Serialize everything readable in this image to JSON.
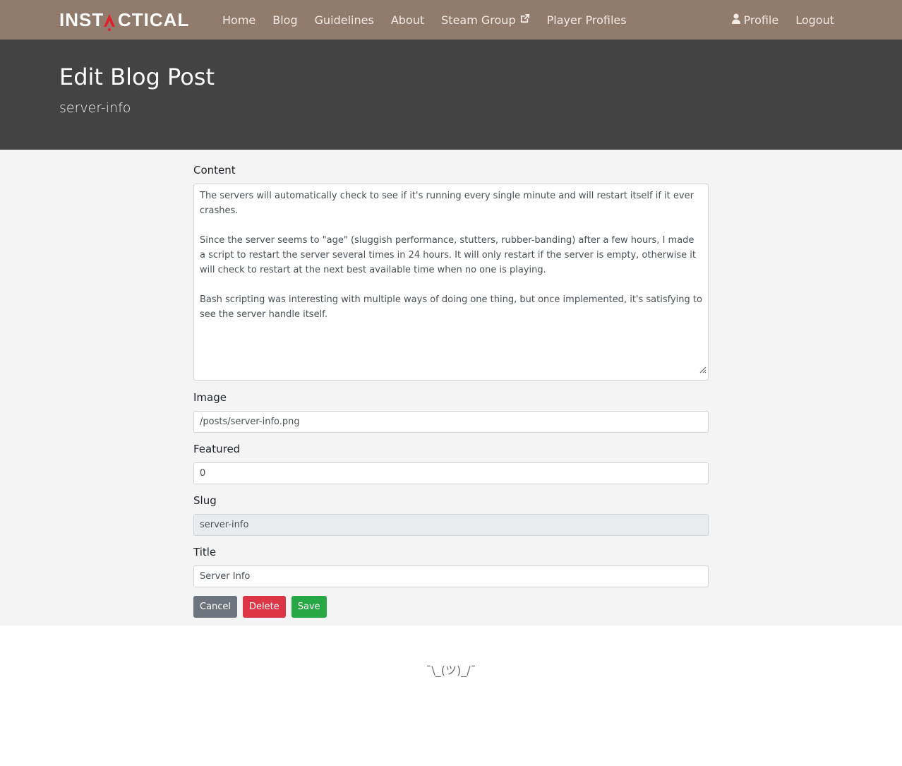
{
  "brand": {
    "logo_text_left": "INST",
    "logo_text_right": "CTICAL",
    "accent_color": "#e0202a"
  },
  "nav": {
    "items": [
      {
        "label": "Home"
      },
      {
        "label": "Blog"
      },
      {
        "label": "Guidelines"
      },
      {
        "label": "About"
      },
      {
        "label": "Steam Group",
        "icon": "external-link-icon"
      },
      {
        "label": "Player Profiles"
      }
    ],
    "right": {
      "profile_label": "Profile",
      "profile_icon": "user-icon",
      "logout_label": "Logout"
    },
    "bg_color": "#917b6c"
  },
  "header": {
    "title": "Edit Blog Post",
    "subtitle": "server-info",
    "bg_color": "#434343"
  },
  "form": {
    "content": {
      "label": "Content",
      "paragraphs": [
        "The servers will automatically check to see if it's running every single minute and will restart itself if it ever crashes.",
        "Since the server seems to \"age\" (sluggish performance, stutters, rubber-banding) after a few hours, I made a script to restart the server several times in 24 hours. It will only restart if the server is empty, otherwise it will check to restart at the next best available time when no one is playing.",
        "Bash scripting was interesting with multiple ways of doing one thing, but once implemented, it's satisfying to see the server handle itself."
      ]
    },
    "image": {
      "label": "Image",
      "value": "/posts/server-info.png"
    },
    "featured": {
      "label": "Featured",
      "value": "0"
    },
    "slug": {
      "label": "Slug",
      "value": "server-info"
    },
    "title": {
      "label": "Title",
      "value": "Server Info"
    },
    "buttons": {
      "cancel": "Cancel",
      "delete": "Delete",
      "save": "Save"
    }
  },
  "footer": {
    "shrug": "¯\\_(ツ)_/¯"
  }
}
